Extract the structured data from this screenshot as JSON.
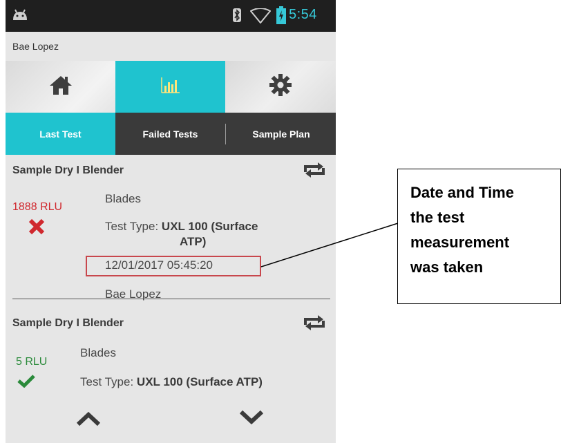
{
  "status_bar": {
    "time": "5:54",
    "icons": [
      "android-icon",
      "bluetooth-icon",
      "wifi-icon",
      "battery-icon"
    ]
  },
  "user": {
    "name": "Bae Lopez"
  },
  "nav": {
    "items": [
      {
        "name": "home",
        "icon": "home-icon"
      },
      {
        "name": "results",
        "icon": "bar-chart-icon",
        "active": true
      },
      {
        "name": "settings",
        "icon": "gear-icon"
      }
    ]
  },
  "tabs": [
    {
      "label": "Last Test",
      "active": true
    },
    {
      "label": "Failed Tests"
    },
    {
      "label": "Sample Plan"
    }
  ],
  "tests": [
    {
      "title": "Sample Dry I Blender",
      "rlu": "1888 RLU",
      "result": "fail",
      "location": "Blades",
      "type_label": "Test Type:",
      "type_value_1": "UXL 100 (Surface",
      "type_value_2": "ATP)",
      "datetime": "12/01/2017 05:45:20",
      "user": "Bae Lopez"
    },
    {
      "title": "Sample Dry I Blender",
      "rlu": "5 RLU",
      "result": "pass",
      "location": "Blades",
      "type_label": "Test Type:",
      "type_value": "UXL 100 (Surface ATP)"
    }
  ],
  "callout": {
    "lines": [
      "Date and Time",
      "the test",
      "measurement",
      "was taken"
    ]
  },
  "colors": {
    "accent": "#1fc3cf",
    "fail": "#d0282e",
    "pass": "#2a8a3a",
    "highlight": "#c8474d"
  }
}
